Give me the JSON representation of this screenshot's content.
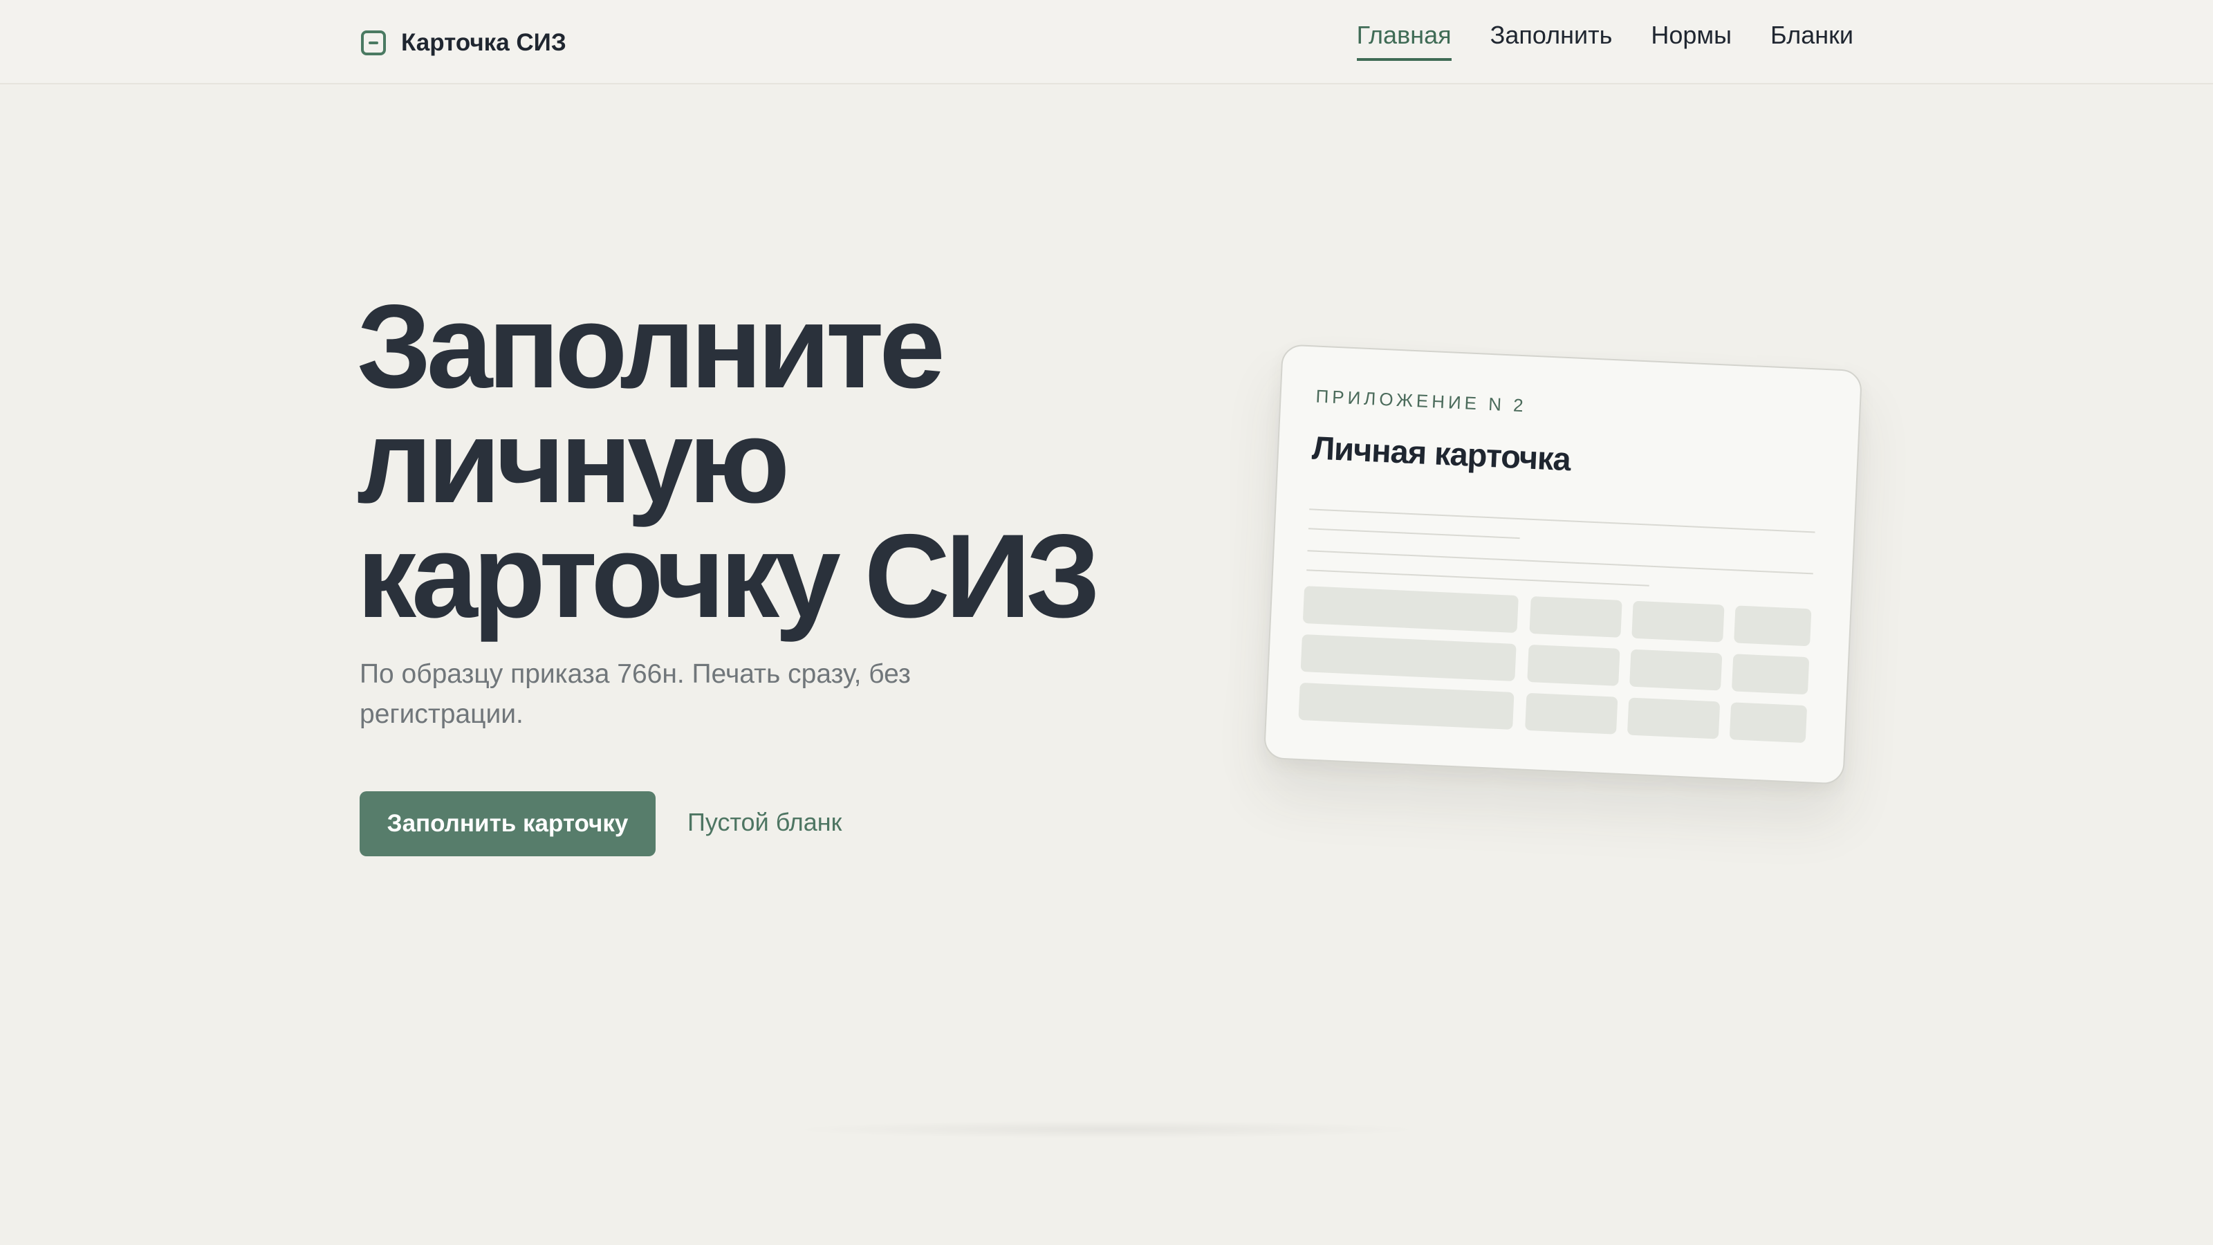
{
  "header": {
    "brand": "Карточка СИЗ",
    "nav": [
      "Главная",
      "Заполнить",
      "Нормы",
      "Бланки"
    ]
  },
  "hero": {
    "title_lines": [
      "Заполните",
      "личную",
      "карточку СИЗ"
    ],
    "subtitle": "По образцу приказа 766н. Печать сразу, без регистрации.",
    "primary_button": "Заполнить карточку",
    "secondary_link": "Пустой бланк"
  },
  "card": {
    "label": "ПРИЛОЖЕНИЕ N 2",
    "title": "Личная карточка"
  },
  "colors": {
    "accent": "#577d6b",
    "background": "#f1f0eb",
    "text": "#2a313b"
  },
  "icons": {
    "brand": "card-icon"
  }
}
